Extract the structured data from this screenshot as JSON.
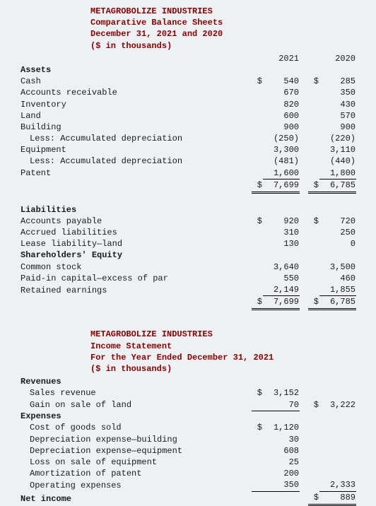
{
  "bs": {
    "company": "METAGROBOLIZE INDUSTRIES",
    "title": "Comparative Balance Sheets",
    "date": "December 31, 2021 and 2020",
    "units": "($ in thousands)",
    "y1": "2021",
    "y2": "2020",
    "s_assets": "Assets",
    "cash": {
      "l": "Cash",
      "v1": "540",
      "v2": "285"
    },
    "ar": {
      "l": "Accounts receivable",
      "v1": "670",
      "v2": "350"
    },
    "inv": {
      "l": "Inventory",
      "v1": "820",
      "v2": "430"
    },
    "land": {
      "l": "Land",
      "v1": "600",
      "v2": "570"
    },
    "bldg": {
      "l": "Building",
      "v1": "900",
      "v2": "900"
    },
    "bldg_ad": {
      "l": "Less: Accumulated depreciation",
      "v1": "(250)",
      "v2": "(220)"
    },
    "equip": {
      "l": "Equipment",
      "v1": "3,300",
      "v2": "3,110"
    },
    "equip_ad": {
      "l": "Less: Accumulated depreciation",
      "v1": "(481)",
      "v2": "(440)"
    },
    "patent": {
      "l": "Patent",
      "v1": "1,600",
      "v2": "1,800"
    },
    "total_a": {
      "v1": "7,699",
      "v2": "6,785"
    },
    "s_liab": "Liabilities",
    "ap": {
      "l": "Accounts payable",
      "v1": "920",
      "v2": "720"
    },
    "accr": {
      "l": "Accrued liabilities",
      "v1": "310",
      "v2": "250"
    },
    "lease": {
      "l": "Lease liability—land",
      "v1": "130",
      "v2": "0"
    },
    "s_eq": "Shareholders' Equity",
    "cs": {
      "l": "Common stock",
      "v1": "3,640",
      "v2": "3,500"
    },
    "pic": {
      "l": "Paid-in capital—excess of par",
      "v1": "550",
      "v2": "460"
    },
    "re": {
      "l": "Retained earnings",
      "v1": "2,149",
      "v2": "1,855"
    },
    "total_le": {
      "v1": "7,699",
      "v2": "6,785"
    },
    "d": "$"
  },
  "is": {
    "company": "METAGROBOLIZE INDUSTRIES",
    "title": "Income Statement",
    "date": "For the Year Ended December 31, 2021",
    "units": "($ in thousands)",
    "s_rev": "Revenues",
    "sales": {
      "l": "Sales revenue",
      "v": "3,152"
    },
    "gain": {
      "l": "Gain on sale of land",
      "v": "70",
      "t": "3,222"
    },
    "s_exp": "Expenses",
    "cogs": {
      "l": "Cost of goods sold",
      "v": "1,120"
    },
    "depb": {
      "l": "Depreciation expense—building",
      "v": "30"
    },
    "depe": {
      "l": "Depreciation expense—equipment",
      "v": "608"
    },
    "loss": {
      "l": "Loss on sale of equipment",
      "v": "25"
    },
    "amort": {
      "l": "Amortization of patent",
      "v": "200"
    },
    "opex": {
      "l": "Operating expenses",
      "v": "350",
      "t": "2,333"
    },
    "net": {
      "l": "Net income",
      "v": "889"
    },
    "d": "$"
  }
}
